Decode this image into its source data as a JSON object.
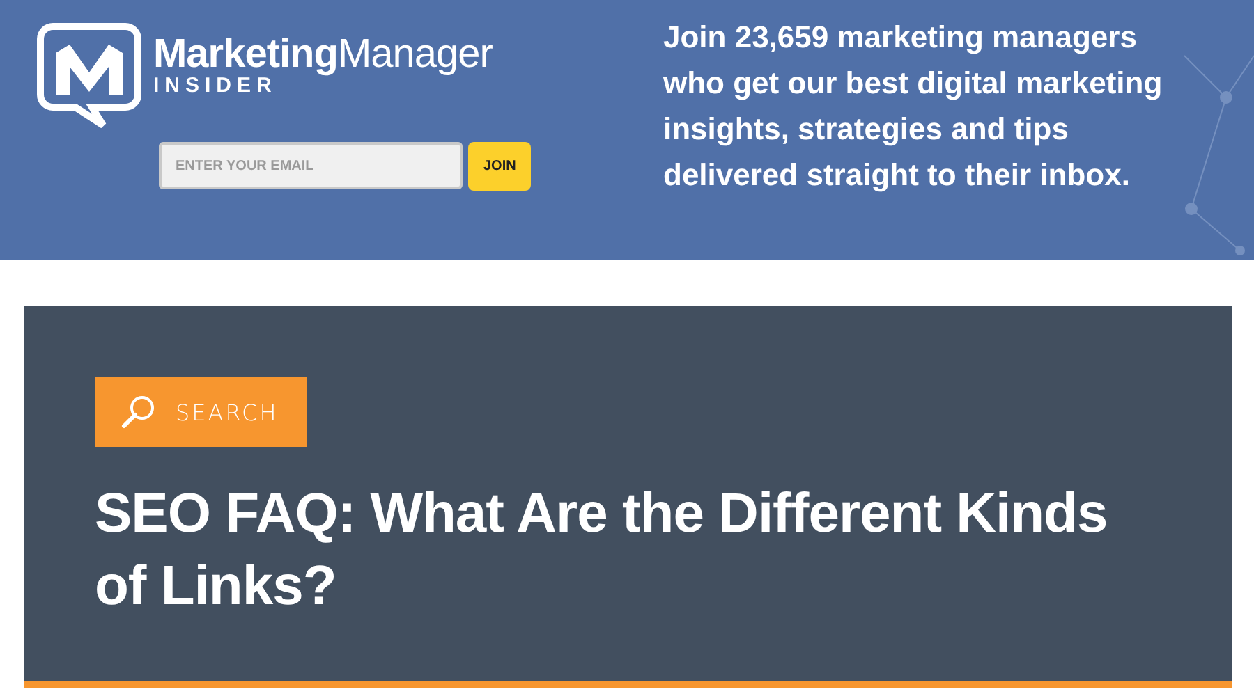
{
  "header": {
    "logo": {
      "wordmark": "**Marketing**Manager",
      "tagline": "INSIDER"
    },
    "signup": {
      "email_placeholder": "ENTER YOUR EMAIL",
      "button": "JOIN"
    },
    "pitch": "Join 23,659 marketing managers who get our best digital marketing insights, strategies and tips delivered straight to their inbox."
  },
  "hero": {
    "search_button": "SEARCH",
    "title": "SEO FAQ: What Are the Different Kinds of Links?"
  }
}
